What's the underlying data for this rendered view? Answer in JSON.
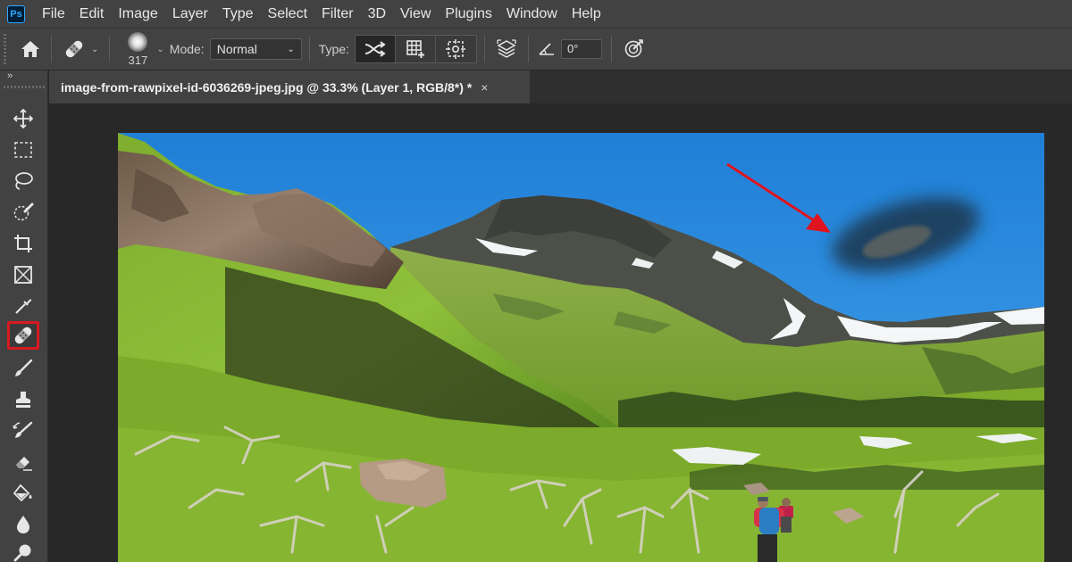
{
  "app": {
    "logo": "Ps"
  },
  "menu": [
    "File",
    "Edit",
    "Image",
    "Layer",
    "Type",
    "Select",
    "Filter",
    "3D",
    "View",
    "Plugins",
    "Window",
    "Help"
  ],
  "options": {
    "brush_size": "317",
    "mode_label": "Mode:",
    "mode_value": "Normal",
    "type_label": "Type:",
    "type_buttons": [
      "proximity-match",
      "create-texture",
      "content-aware"
    ],
    "type_active": 0,
    "angle_value": "0°"
  },
  "toolbar": {
    "collapse": "››",
    "selected_tool": "spot-healing-brush-tool",
    "tools": [
      "move",
      "rectangular-marquee",
      "lasso",
      "quick-selection",
      "crop",
      "frame",
      "eyedropper",
      "spot-healing-brush",
      "brush",
      "clone-stamp",
      "history-brush",
      "eraser",
      "paint-bucket",
      "blur",
      "dodge"
    ]
  },
  "document": {
    "tab_title": "image-from-rawpixel-id-6036269-jpeg.jpg @ 33.3% (Layer 1, RGB/8*) *",
    "close": "×"
  },
  "colors": {
    "chrome": "#424242",
    "canvas_bg": "#282828",
    "highlight": "#d71920",
    "arrow": "#e0141e",
    "sky": "#2f8fe0"
  }
}
